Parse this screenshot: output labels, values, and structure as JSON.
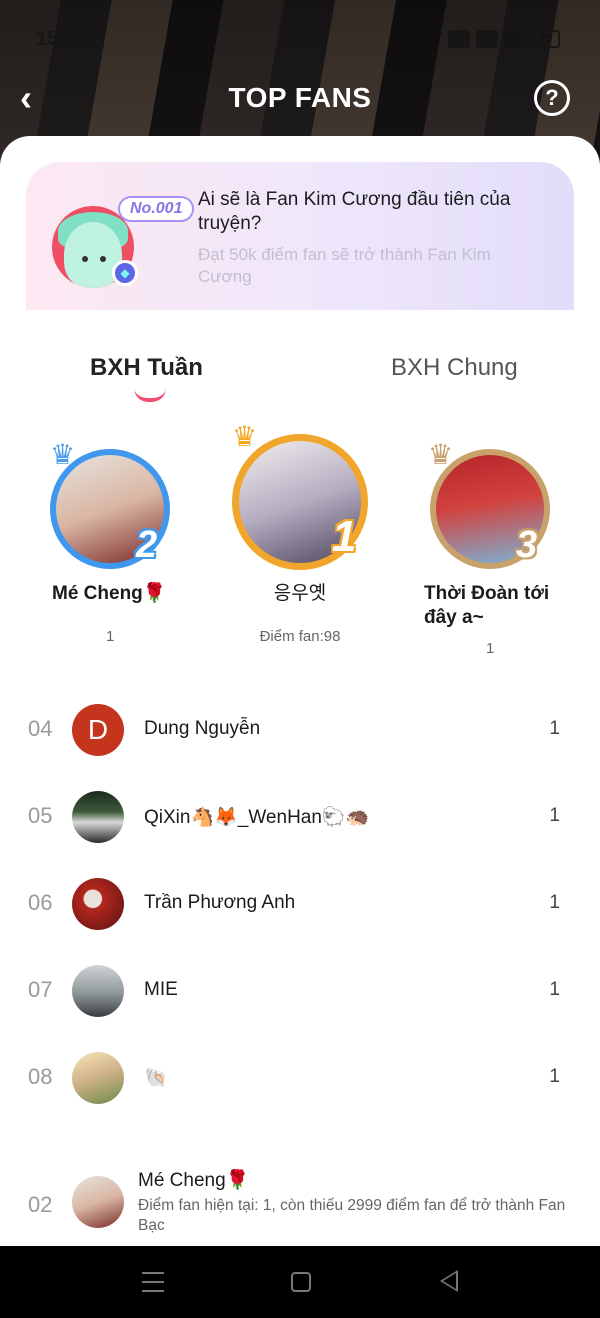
{
  "status_bar": {
    "time": "15:58",
    "battery": "77"
  },
  "header": {
    "title": "TOP FANS",
    "back_icon": "chevron-left-icon",
    "help_icon": "question-circle-icon"
  },
  "banner": {
    "badge": "No.001",
    "title": "Ai sẽ là Fan Kim Cương đầu tiên của truyện?",
    "subtitle": "Đạt 50k điểm fan sẽ trở thành Fan Kim Cương"
  },
  "tabs": [
    {
      "label": "BXH Tuần",
      "active": true
    },
    {
      "label": "BXH Chung",
      "active": false
    }
  ],
  "podium": [
    {
      "rank": "2",
      "name": "Mé Cheng🌹",
      "score": "1"
    },
    {
      "rank": "1",
      "name": "응우옛",
      "score": "Điểm fan:98"
    },
    {
      "rank": "3",
      "name": "Thời Đoàn tới đây a~",
      "score": "1"
    }
  ],
  "list": [
    {
      "rank": "04",
      "name": "Dung Nguyễn",
      "score": "1",
      "avatar_letter": "D"
    },
    {
      "rank": "05",
      "name": "QiXin🐴🦊_WenHan🐑🦔",
      "score": "1"
    },
    {
      "rank": "06",
      "name": "Trần Phương Anh",
      "score": "1"
    },
    {
      "rank": "07",
      "name": "MIE",
      "score": "1"
    },
    {
      "rank": "08",
      "name": "🐚",
      "score": "1"
    }
  ],
  "my_rank": {
    "rank": "02",
    "name": "Mé Cheng🌹",
    "description": "Điểm fan hiện tại: 1, còn thiếu 2999 điểm fan để trở thành Fan Bạc"
  },
  "colors": {
    "accent": "#f24d73",
    "rank1": "#f1a52a",
    "rank2": "#3f98ee",
    "rank3": "#c8a26a"
  }
}
